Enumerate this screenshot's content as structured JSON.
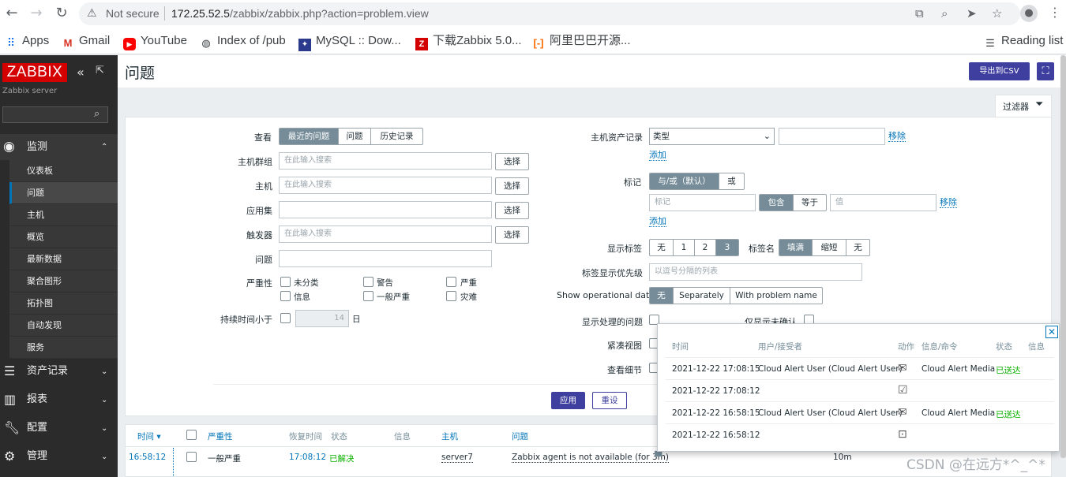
{
  "browser": {
    "security_label": "Not secure",
    "url_host": "172.25.52.5",
    "url_path": "/zabbix/zabbix.php?action=problem.view",
    "bookmarks": [
      {
        "label": "Apps",
        "icon": "apps-grid-icon"
      },
      {
        "label": "Gmail",
        "icon": "gmail-icon"
      },
      {
        "label": "YouTube",
        "icon": "youtube-icon"
      },
      {
        "label": "Index of /pub",
        "icon": "globe-icon"
      },
      {
        "label": "MySQL :: Dow...",
        "icon": "mysql-icon"
      },
      {
        "label": "下载Zabbix 5.0...",
        "icon": "zabbix-icon"
      },
      {
        "label": "阿里巴巴开源...",
        "icon": "aliyun-icon"
      }
    ],
    "reading_list": "Reading list"
  },
  "sidebar": {
    "logo": "ZABBIX",
    "server": "Zabbix server",
    "monitoring": "监测",
    "submenu": [
      "仪表板",
      "问题",
      "主机",
      "概览",
      "最新数据",
      "聚合图形",
      "拓扑图",
      "自动发现",
      "服务"
    ],
    "selected_index": 1,
    "sections": [
      "资产记录",
      "报表",
      "配置",
      "管理"
    ]
  },
  "header": {
    "title": "问题",
    "export_csv": "导出到CSV"
  },
  "filter": {
    "tab_label": "过滤器",
    "view_label": "查看",
    "view_options": [
      "最近的问题",
      "问题",
      "历史记录"
    ],
    "host_groups_label": "主机群组",
    "hosts_label": "主机",
    "application_label": "应用集",
    "triggers_label": "触发器",
    "problem_label": "问题",
    "severity_label": "严重性",
    "severities": [
      "未分类",
      "警告",
      "严重",
      "信息",
      "一般严重",
      "灾难"
    ],
    "age_label": "持续时间小于",
    "age_value": "14",
    "age_unit": "日",
    "search_placeholder": "在此输入搜索",
    "select_btn": "选择",
    "inventory_label": "主机资产记录",
    "inventory_field": "类型",
    "remove": "移除",
    "add": "添加",
    "tags_label": "标记",
    "tag_ops": [
      "与/或（默认）",
      "或"
    ],
    "tag_placeholder": "标记",
    "tag_match": [
      "包含",
      "等于"
    ],
    "value_placeholder": "值",
    "show_tags_label": "显示标签",
    "show_tags": [
      "无",
      "1",
      "2",
      "3"
    ],
    "tag_name_label": "标签名",
    "tag_name_opts": [
      "填满",
      "缩短",
      "无"
    ],
    "tag_priority_label": "标签显示优先级",
    "tag_priority_placeholder": "以逗号分隔的列表",
    "op_data_label": "Show operational data",
    "op_data_opts": [
      "无",
      "Separately",
      "With problem name"
    ],
    "show_suppressed_label": "显示处理的问题",
    "unack_label": "仅显示未确认",
    "compact_label": "紧凑视图",
    "details_label": "查看细节",
    "apply": "应用",
    "reset": "重设"
  },
  "problems": {
    "headers": [
      "时间 ▾",
      "严重性",
      "恢复时间",
      "状态",
      "信息",
      "主机",
      "问题"
    ],
    "rows": [
      {
        "time": "16:58:12",
        "severity": "一般严重",
        "recovery": "17:08:12",
        "status": "已解决",
        "host": "server7",
        "problem": "Zabbix agent is not available (for 3m)",
        "duration": "10m"
      }
    ]
  },
  "popup": {
    "headers": [
      "时间",
      "用户/接受者",
      "动作",
      "信息/命令",
      "状态",
      "信息"
    ],
    "rows": [
      {
        "time": "2021-12-22 17:08:15",
        "user": "Cloud Alert User (Cloud Alert User)",
        "action": "mail-icon",
        "media": "Cloud Alert Media",
        "status": "已送达"
      },
      {
        "time": "2021-12-22 17:08:12",
        "user": "",
        "action": "calendar-check-icon",
        "media": "",
        "status": ""
      },
      {
        "time": "2021-12-22 16:58:15",
        "user": "Cloud Alert User (Cloud Alert User)",
        "action": "mail-icon",
        "media": "Cloud Alert Media",
        "status": "已送达"
      },
      {
        "time": "2021-12-22 16:58:12",
        "user": "",
        "action": "calendar-alert-icon",
        "media": "",
        "status": ""
      }
    ]
  },
  "watermark": "CSDN @在远方*^_^*",
  "colors": {
    "brand": "#d40000",
    "accent": "#3f3f9f",
    "link": "#0275b8",
    "ok": "#0bb000"
  }
}
